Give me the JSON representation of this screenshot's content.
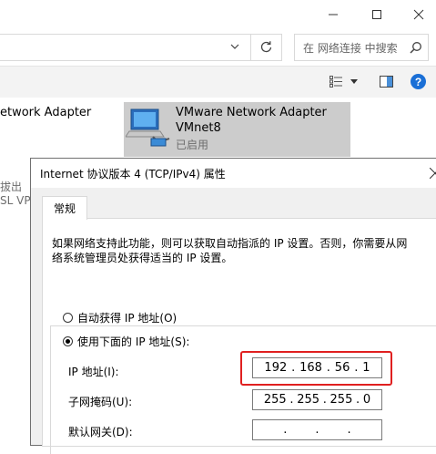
{
  "titlebar": {
    "minimize_icon": "minimize-icon",
    "maximize_icon": "maximize-icon",
    "close_icon": "close-icon"
  },
  "address": {
    "dropdown_icon": "chevron-down-icon",
    "refresh_icon": "refresh-icon",
    "search_placeholder": "在 网络连接 中搜索"
  },
  "toolbar": {
    "view_icon": "view-options-icon",
    "pane_icon": "preview-pane-icon",
    "help_icon": "help-icon"
  },
  "network_items": [
    {
      "name_partial": "etwork Adapter"
    },
    {
      "name": "VMware Network Adapter",
      "subname": "VMnet8",
      "status": "已启用"
    }
  ],
  "background_fragments": [
    "拔出",
    "SL VPN"
  ],
  "dialog": {
    "title": "Internet 协议版本 4 (TCP/IPv4) 属性",
    "tab": "常规",
    "description": [
      "如果网络支持此功能，则可以获取自动指派的 IP 设置。否则，你需要从网",
      "络系统管理员处获得适当的 IP 设置。"
    ],
    "radio_auto": "自动获得 IP 地址(O)",
    "radio_manual": "使用下面的 IP 地址(S):",
    "radio_selected": "manual",
    "ip_label": "IP 地址(I):",
    "ip": [
      "192",
      "168",
      "56",
      "1"
    ],
    "mask_label": "子网掩码(U):",
    "mask": [
      "255",
      "255",
      "255",
      "0"
    ],
    "gateway_label": "默认网关(D):",
    "gateway": [
      "",
      "",
      "",
      ""
    ],
    "highlight_color": "#e02020"
  }
}
